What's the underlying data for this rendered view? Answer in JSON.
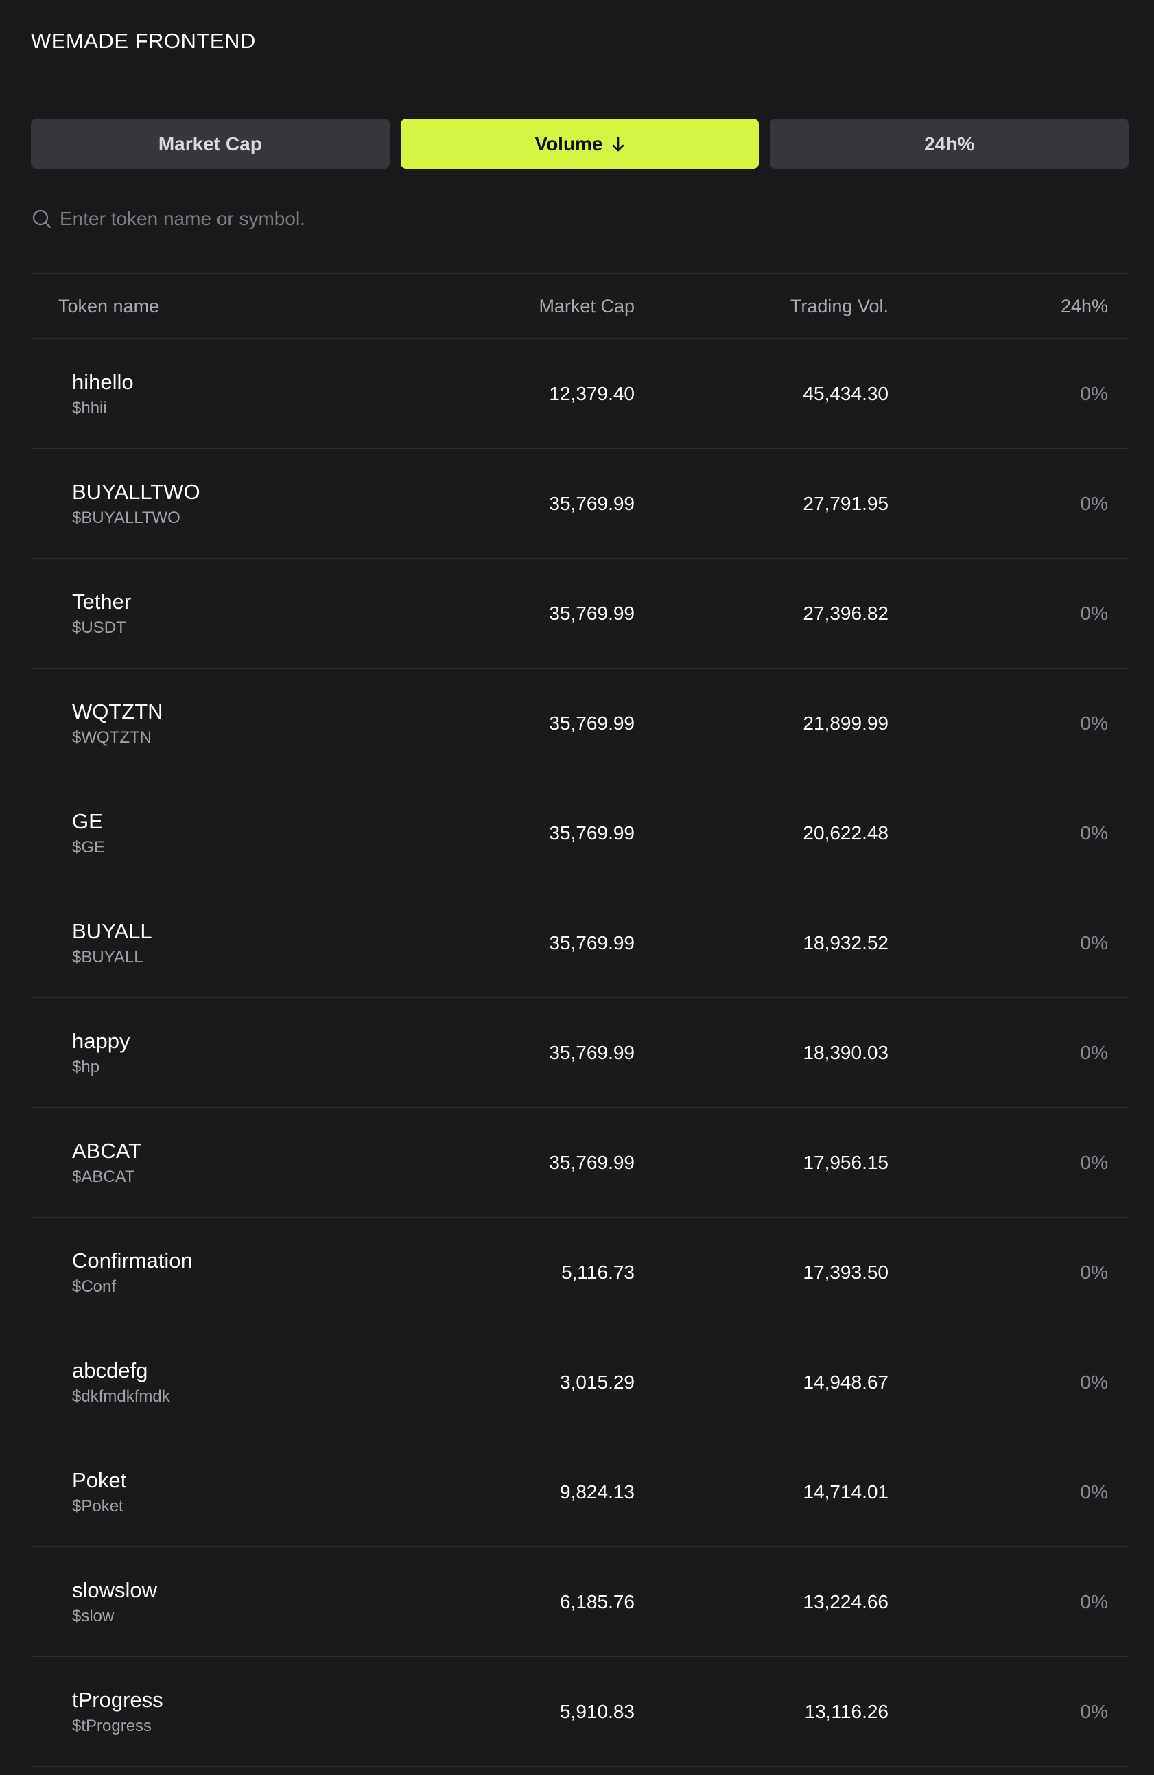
{
  "app": {
    "title": "WEMADE FRONTEND"
  },
  "tabs": [
    {
      "label": "Market Cap",
      "active": false
    },
    {
      "label": "Volume",
      "active": true,
      "icon": "arrow-down-icon"
    },
    {
      "label": "24h%",
      "active": false
    }
  ],
  "search": {
    "placeholder": "Enter token name or symbol.",
    "value": ""
  },
  "table": {
    "headers": {
      "name": "Token name",
      "market_cap": "Market Cap",
      "volume": "Trading Vol.",
      "change": "24h%"
    },
    "rows": [
      {
        "name": "hihello",
        "symbol": "$hhii",
        "market_cap": "12,379.40",
        "volume": "45,434.30",
        "change": "0%"
      },
      {
        "name": "BUYALLTWO",
        "symbol": "$BUYALLTWO",
        "market_cap": "35,769.99",
        "volume": "27,791.95",
        "change": "0%"
      },
      {
        "name": "Tether",
        "symbol": "$USDT",
        "market_cap": "35,769.99",
        "volume": "27,396.82",
        "change": "0%"
      },
      {
        "name": "WQTZTN",
        "symbol": "$WQTZTN",
        "market_cap": "35,769.99",
        "volume": "21,899.99",
        "change": "0%"
      },
      {
        "name": "GE",
        "symbol": "$GE",
        "market_cap": "35,769.99",
        "volume": "20,622.48",
        "change": "0%"
      },
      {
        "name": "BUYALL",
        "symbol": "$BUYALL",
        "market_cap": "35,769.99",
        "volume": "18,932.52",
        "change": "0%"
      },
      {
        "name": "happy",
        "symbol": "$hp",
        "market_cap": "35,769.99",
        "volume": "18,390.03",
        "change": "0%"
      },
      {
        "name": "ABCAT",
        "symbol": "$ABCAT",
        "market_cap": "35,769.99",
        "volume": "17,956.15",
        "change": "0%"
      },
      {
        "name": "Confirmation",
        "symbol": "$Conf",
        "market_cap": "5,116.73",
        "volume": "17,393.50",
        "change": "0%"
      },
      {
        "name": "abcdefg",
        "symbol": "$dkfmdkfmdk",
        "market_cap": "3,015.29",
        "volume": "14,948.67",
        "change": "0%"
      },
      {
        "name": "Poket",
        "symbol": "$Poket",
        "market_cap": "9,824.13",
        "volume": "14,714.01",
        "change": "0%"
      },
      {
        "name": "slowslow",
        "symbol": "$slow",
        "market_cap": "6,185.76",
        "volume": "13,224.66",
        "change": "0%"
      },
      {
        "name": "tProgress",
        "symbol": "$tProgress",
        "market_cap": "5,910.83",
        "volume": "13,116.26",
        "change": "0%"
      }
    ]
  },
  "colors": {
    "background": "#1a1a1c",
    "accent": "#d4f542",
    "tab_inactive": "#36363b",
    "divider": "#2e2e32"
  }
}
